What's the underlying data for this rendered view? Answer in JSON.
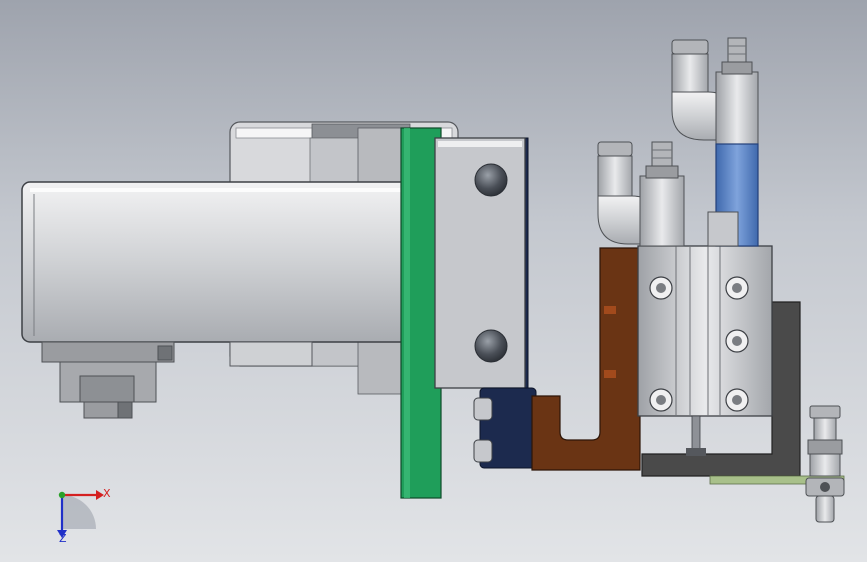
{
  "viewport": {
    "background_top": "#9ea3ad",
    "background_bottom": "#e2e4e7"
  },
  "colors": {
    "steel": "#c9cbcf",
    "steel_dark": "#8e9197",
    "green_plate": "#1f9e5a",
    "navy_block": "#1c2a4e",
    "brown_bracket": "#6a3414",
    "blue_cylinder": "#5b84c4",
    "dark_bracket": "#4a4a4a",
    "olive_strip": "#a8c08a"
  },
  "triad": {
    "x_label": "X",
    "z_label": "Z",
    "x_color": "#d42020",
    "y_color": "#2aa02a",
    "z_color": "#2030c8"
  }
}
